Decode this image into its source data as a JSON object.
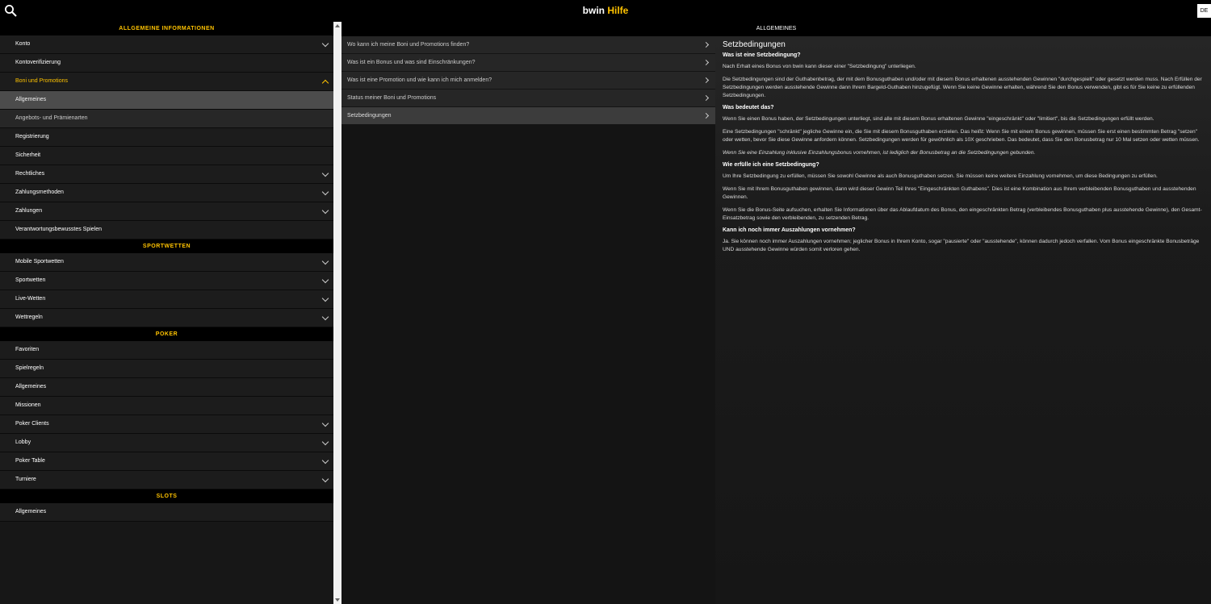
{
  "header": {
    "brand_main": "bwin",
    "brand_accent": "Hilfe",
    "lang": "DE",
    "search_icon": "search-icon"
  },
  "colors": {
    "accent": "#ffc300",
    "background": "#1b1b1b",
    "topbar": "#000000"
  },
  "sidebar": {
    "sections": [
      {
        "title": "ALLGEMEINE INFORMATIONEN",
        "items": [
          {
            "label": "Konto",
            "expandable": true
          },
          {
            "label": "Kontoverifizierung"
          },
          {
            "label": "Boni und Promotions",
            "expanded": true,
            "active": true,
            "children": [
              {
                "label": "Allgemeines",
                "selected": true
              },
              {
                "label": "Angebots- und Prämienarten"
              }
            ]
          },
          {
            "label": "Registrierung"
          },
          {
            "label": "Sicherheit"
          },
          {
            "label": "Rechtliches",
            "expandable": true
          },
          {
            "label": "Zahlungsmethoden",
            "expandable": true
          },
          {
            "label": "Zahlungen",
            "expandable": true
          },
          {
            "label": "Verantwortungsbewusstes Spielen"
          }
        ]
      },
      {
        "title": "SPORTWETTEN",
        "items": [
          {
            "label": "Mobile Sportwetten",
            "expandable": true
          },
          {
            "label": "Sportwetten",
            "expandable": true
          },
          {
            "label": "Live-Wetten",
            "expandable": true
          },
          {
            "label": "Wettregeln",
            "expandable": true
          }
        ]
      },
      {
        "title": "POKER",
        "items": [
          {
            "label": "Favoriten"
          },
          {
            "label": "Spielregeln"
          },
          {
            "label": "Allgemeines"
          },
          {
            "label": "Missionen"
          },
          {
            "label": "Poker Clients",
            "expandable": true
          },
          {
            "label": "Lobby",
            "expandable": true
          },
          {
            "label": "Poker Table",
            "expandable": true
          },
          {
            "label": "Turniere",
            "expandable": true
          }
        ]
      },
      {
        "title": "SLOTS",
        "items": [
          {
            "label": "Allgemeines"
          }
        ]
      }
    ]
  },
  "middle": {
    "title": "ALLGEMEINES",
    "faqs": [
      {
        "label": "Wo kann ich meine Boni und Promotions finden?"
      },
      {
        "label": "Was ist ein Bonus und was sind Einschränkungen?"
      },
      {
        "label": "Was ist eine Promotion und wie kann ich mich anmelden?"
      },
      {
        "label": "Status meiner Boni und Promotions"
      },
      {
        "label": "Setzbedingungen",
        "selected": true
      }
    ]
  },
  "article": {
    "title": "Setzbedingungen",
    "blocks": [
      {
        "type": "h",
        "text": "Was ist eine Setzbedingung?"
      },
      {
        "type": "p",
        "text": "Nach Erhalt eines Bonus von bwin kann dieser einer \"Setzbedingung\" unterliegen."
      },
      {
        "type": "p",
        "text": "Die Setzbedingungen sind der Guthabenbetrag, der mit dem Bonusguthaben und/oder mit diesem Bonus erhaltenen ausstehenden Gewinnen \"durchgespielt\" oder gesetzt werden muss. Nach Erfüllen der Setzbedingungen werden ausstehende Gewinne dann Ihrem Bargeld-Guthaben hinzugefügt. Wenn Sie keine Gewinne erhalten, während Sie den Bonus verwenden, gibt es für Sie keine zu erfüllenden Setzbedingungen."
      },
      {
        "type": "h",
        "text": "Was bedeutet das?"
      },
      {
        "type": "p",
        "text": "Wenn Sie einen Bonus haben, der Setzbedingungen unterliegt, sind alle mit diesem Bonus erhaltenen Gewinne \"eingeschränkt\" oder \"limitiert\", bis die Setzbedingungen erfüllt werden."
      },
      {
        "type": "p",
        "text": "Eine Setzbedingungen \"schränkt\" jegliche Gewinne ein, die Sie mit diesem Bonusguthaben erzielen. Das heißt: Wenn Sie mit einem Bonus gewinnen, müssen Sie erst einen bestimmten Betrag \"setzen\" oder wetten, bevor Sie diese Gewinne anfordern können. Setzbedingungen werden für gewöhnlich als 10X geschrieben. Das bedeutet, dass Sie den Bonusbetrag nur 10 Mal setzen oder wetten müssen."
      },
      {
        "type": "pi",
        "text": "Wenn Sie eine Einzahlung inklusive Einzahlungsbonus vornehmen, ist lediglich der Bonusbetrag an die Setzbedingungen gebunden."
      },
      {
        "type": "h",
        "text": "Wie erfülle ich eine Setzbedingung?"
      },
      {
        "type": "p",
        "text": "Um Ihre Setzbedingung zu erfüllen, müssen Sie sowohl Gewinne als auch Bonusguthaben setzen. Sie müssen keine weitere Einzahlung vornehmen, um diese Bedingungen zu erfüllen."
      },
      {
        "type": "p",
        "text": "Wenn Sie mit Ihrem Bonusguthaben gewinnen, dann wird dieser Gewinn Teil Ihres \"Eingeschränkten Guthabens\". Dies ist eine Kombination aus Ihrem verbleibenden Bonusguthaben und ausstehenden Gewinnen."
      },
      {
        "type": "p",
        "text": "Wenn Sie die Bonus-Seite aufsuchen, erhalten Sie Informationen über das Ablaufdatum des Bonus, den eingeschränkten Betrag (verbleibendes Bonusguthaben plus ausstehende Gewinne), den Gesamt-Einsatzbetrag sowie den verbleibenden, zu setzenden Betrag."
      },
      {
        "type": "h",
        "text": "Kann ich noch immer Auszahlungen vornehmen?"
      },
      {
        "type": "p",
        "text": "Ja. Sie können noch immer Auszahlungen vornehmen; jeglicher Bonus in Ihrem Konto, sogar \"pausierte\" oder \"ausstehende\", können dadurch jedoch verfallen. Vom Bonus eingeschränkte Bonusbeträge UND ausstehende Gewinne würden somit verloren gehen."
      }
    ]
  }
}
